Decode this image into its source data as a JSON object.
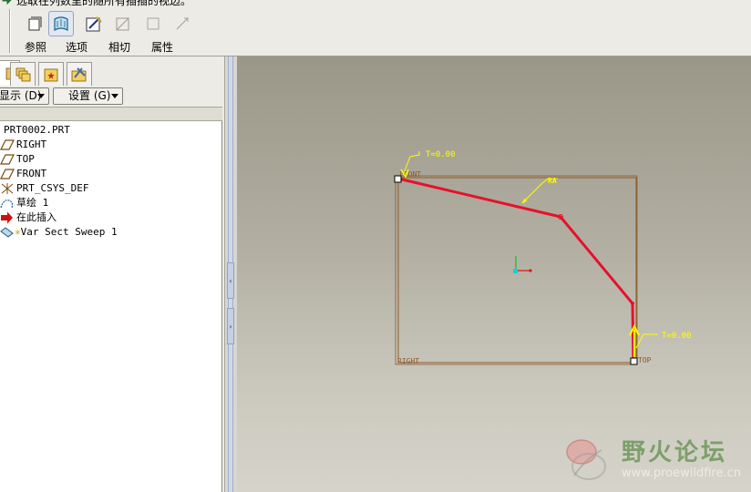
{
  "prompt": {
    "text": "选取在列数里的随所有插插的视边。"
  },
  "dashboard": {
    "buttons": [
      {
        "label": "参照",
        "icon": "reference-icon"
      },
      {
        "label": "选项",
        "icon": "options-icon",
        "active": true
      },
      {
        "label": "相切",
        "icon": "tangency-icon"
      },
      {
        "label": "属性",
        "icon": "properties-icon"
      }
    ]
  },
  "navigator": {
    "tabs": [
      "model-tree-tab",
      "layer-tree-tab",
      "folder-browser-tab",
      "favorites-tab"
    ],
    "show_dropdown": "显示 (D)",
    "settings_dropdown": "设置 (G)"
  },
  "model_tree": {
    "items": [
      {
        "label": "PRT0002.PRT",
        "icon": "part-icon"
      },
      {
        "label": "RIGHT",
        "icon": "datum-plane-icon"
      },
      {
        "label": "TOP",
        "icon": "datum-plane-icon"
      },
      {
        "label": "FRONT",
        "icon": "datum-plane-icon"
      },
      {
        "label": "PRT_CSYS_DEF",
        "icon": "csys-icon"
      },
      {
        "label": "草绘 1",
        "icon": "sketch-icon"
      },
      {
        "label": "在此插入",
        "icon": "insert-here-icon"
      },
      {
        "label": "Var Sect Sweep 1",
        "icon": "var-sect-sweep-icon"
      }
    ]
  },
  "graphics": {
    "labels": {
      "t_start": "T=0.00",
      "t_end": "T=0.00",
      "front": "FRONT",
      "right": "RIGHT",
      "top": "TOP",
      "trajectory": "RA"
    },
    "colors": {
      "trajectory": "#e8102a",
      "datum": "#8a5a2a",
      "annotation": "#ffff00",
      "origin_arrow": "#ffff00"
    }
  },
  "watermark": {
    "title": "野火论坛",
    "url": "www.proewildfire.cn"
  }
}
